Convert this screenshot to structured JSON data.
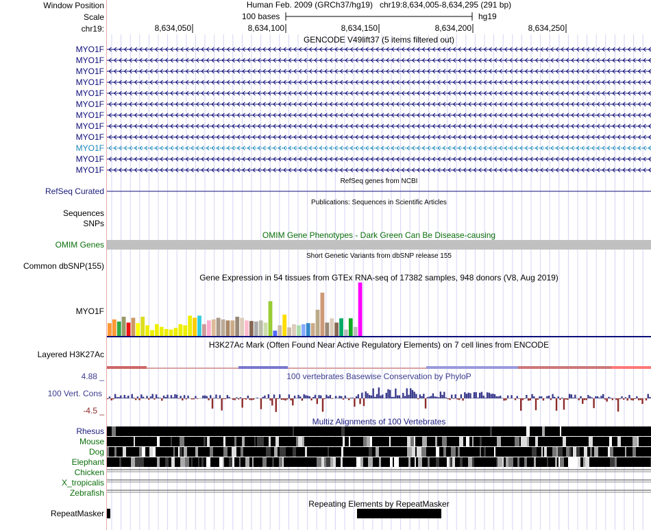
{
  "header": {
    "window_position_label": "Window Position",
    "scale_label": "Scale",
    "chrom_label": "chr19:",
    "assembly": "Human Feb. 2009 (GRCh37/hg19)",
    "position": "chr19:8,634,005-8,634,295 (291 bp)",
    "scale_text": "100 bases",
    "db": "hg19",
    "ticks": [
      "8,634,050",
      "8,634,100",
      "8,634,150",
      "8,634,200",
      "8,634,250"
    ]
  },
  "gencode": {
    "title": "GENCODE V49lift37 (5 items filtered out)",
    "gene": "MYO1F",
    "rows": 12,
    "highlight_row": 9,
    "colors": {
      "normal": "#0c0c78",
      "highlight": "#1a87b8"
    }
  },
  "refseq": {
    "label": "RefSeq Curated",
    "title": "RefSeq genes from NCBI"
  },
  "pubs": {
    "title": "Publications: Sequences in Scientific Articles",
    "label_sequences": "Sequences",
    "label_snps": "SNPs"
  },
  "omim": {
    "label": "OMIM Genes",
    "title": "OMIM Gene Phenotypes - Dark Green Can Be Disease-causing",
    "color": "#0a6e0a",
    "bar_color": "#c0c0c0"
  },
  "dbsnp": {
    "label": "Common dbSNP(155)",
    "title": "Short Genetic Variants from dbSNP release 155"
  },
  "gtex": {
    "title": "Gene Expression in 54 tissues from GTEx RNA-seq of 17382 samples, 948 donors (V8, Aug 2019)",
    "label": "MYO1F",
    "levels": [
      0.24,
      0.31,
      0.27,
      0.36,
      0.25,
      0.34,
      0.24,
      0.36,
      0.2,
      0.11,
      0.22,
      0.17,
      0.13,
      0.12,
      0.15,
      0.22,
      0.2,
      0.38,
      0.34,
      0.38,
      0.22,
      0.29,
      0.31,
      0.34,
      0.31,
      0.29,
      0.29,
      0.36,
      0.34,
      0.29,
      0.28,
      0.27,
      0.29,
      0.25,
      0.65,
      0.1,
      0.2,
      0.4,
      0.16,
      0.22,
      0.2,
      0.22,
      0.24,
      0.24,
      0.49,
      0.81,
      0.25,
      0.33,
      0.25,
      0.33,
      0.12,
      0.33,
      0.17,
      1.0
    ],
    "colors": [
      "#ff9933",
      "#ff9933",
      "#33aa44",
      "#999966",
      "#ee1111",
      "#cc9966",
      "#ffff00",
      "#dddd22",
      "#eeee00",
      "#eeee00",
      "#eeee00",
      "#eeee00",
      "#eeee00",
      "#eeee00",
      "#eeee00",
      "#eeee00",
      "#eeee00",
      "#eeee00",
      "#ffcc00",
      "#33ccdd",
      "#cc9999",
      "#ffaacc",
      "#ddbb99",
      "#aa9988",
      "#bbaa99",
      "#aa8866",
      "#ccaa88",
      "#998877",
      "#ddccbb",
      "#ffbbcc",
      "#886655",
      "#aaaaaa",
      "#bbbbaa",
      "#ccddaa",
      "#99cc33",
      "#5566ff",
      "#ccbbaa",
      "#ffdd00",
      "#ccbbaa",
      "#ddccbb",
      "#aaddaa",
      "#88aaff",
      "#3388cc",
      "#ccaa88",
      "#bbaa88",
      "#cc9977",
      "#998877",
      "#ddccbb",
      "#886655",
      "#00aa66",
      "#bbbbbb",
      "#11aa22",
      "#bbbbbb",
      "#ff00ff"
    ]
  },
  "h3k27ac": {
    "label": "Layered H3K27Ac",
    "title": "H3K27Ac Mark (Often Found Near Active Regulatory Elements) on 7 cell lines from ENCODE"
  },
  "cons": {
    "label": "100 Vert. Cons",
    "title": "100 vertebrates Basewise Conservation by PhyloP",
    "max_label": "4.88 _",
    "min_label": "-4.5 _",
    "pos_color": "#3a3a8c",
    "neg_color": "#8c2a2a"
  },
  "multiz": {
    "title": "Multiz Alignments of 100 Vertebrates",
    "species": [
      "Rhesus",
      "Mouse",
      "Dog",
      "Elephant",
      "Chicken",
      "X_tropicalis",
      "Zebrafish"
    ]
  },
  "rmsk": {
    "label": "RepeatMasker",
    "title": "Repeating Elements by RepeatMasker"
  },
  "colors": {
    "label_blue": "#1a1a7c",
    "label_green": "#0a6e0a",
    "label_cons": "#3b3b8f",
    "label_cons_neg": "#8c2a2a",
    "grid": "#d4d4f4",
    "gene_dark": "#0c0c78"
  }
}
